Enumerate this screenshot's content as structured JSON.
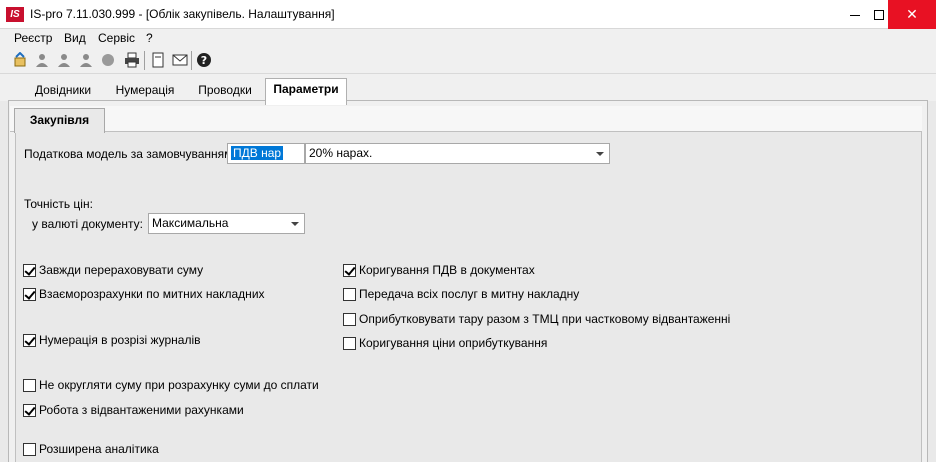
{
  "window": {
    "title": "IS-pro 7.11.030.999 - [Облік закупівель. Налаштування]",
    "logo_text": "IS"
  },
  "menu": [
    "Реєстр",
    "Вид",
    "Сервіс",
    "?"
  ],
  "toolbar": {
    "icons": [
      "refresh-icon",
      "user-icon",
      "user-add-icon",
      "user-remove-icon",
      "stop-icon",
      "print-icon",
      "document-icon",
      "mail-icon",
      "help-icon"
    ]
  },
  "tabs": {
    "items": [
      "Довідники",
      "Нумерація",
      "Проводки",
      "Параметри"
    ],
    "active": "Параметри"
  },
  "inner_tab": "Закупівля",
  "tax_model": {
    "label": "Податкова модель за замовчуванням:",
    "code": "ПДВ нар",
    "value": "20% нарах."
  },
  "price_precision": {
    "heading": "Точність цін:",
    "label": "у валюті документу:",
    "value": "Максимальна"
  },
  "checkboxes_left": [
    {
      "label": "Завжди перераховувати суму",
      "checked": true
    },
    {
      "label": "Взаєморозрахунки по митних накладних",
      "checked": true
    },
    {
      "label": "Нумерація в розрізі журналів",
      "checked": true
    },
    {
      "label": "Не округляти суму при розрахунку суми до сплати",
      "checked": false
    },
    {
      "label": "Робота з відвантаженими рахунками",
      "checked": true
    },
    {
      "label": "Розширена аналітика",
      "checked": false
    }
  ],
  "checkboxes_right": [
    {
      "label": "Коригування ПДВ в документах",
      "checked": true
    },
    {
      "label": "Передача всіх послуг в митну накладну",
      "checked": false
    },
    {
      "label": "Оприбутковувати тару разом з ТМЦ при частковому відвантаженні",
      "checked": false
    },
    {
      "label": "Коригування ціни оприбуткування",
      "checked": false
    }
  ],
  "colors": {
    "close_button": "#e81123",
    "selection": "#0078d7",
    "logo": "#c8102e"
  }
}
